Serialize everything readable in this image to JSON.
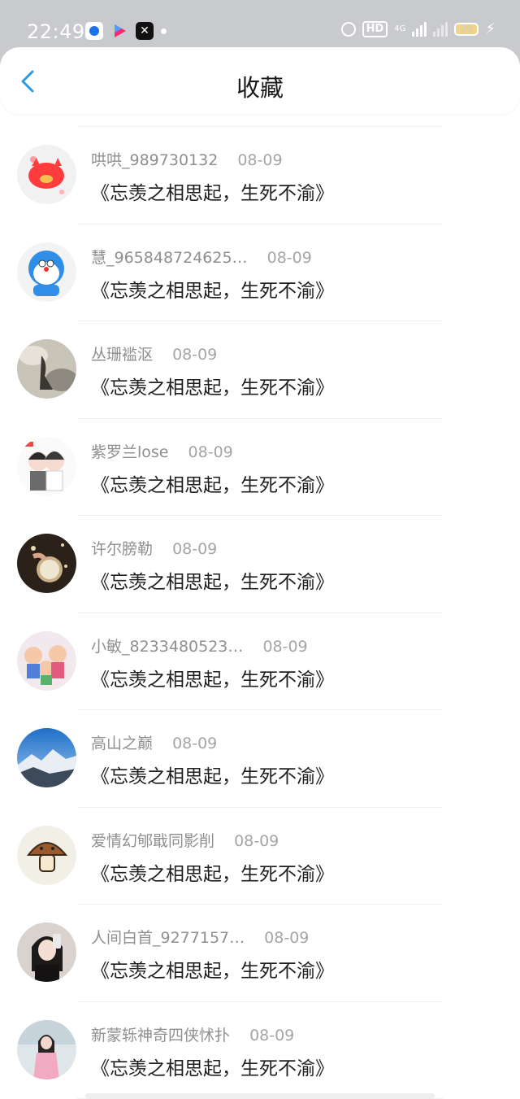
{
  "status_bar": {
    "time": "22:49",
    "hd_badge": "HD",
    "network": "4G",
    "battery": "29"
  },
  "header": {
    "title": "收藏",
    "accent_color": "#2b9ae6"
  },
  "items": [
    {
      "username": "哄哄_989730132",
      "date": "08-09",
      "text": "《忘羡之相思起，生死不渝》",
      "avatar": "pink-pig"
    },
    {
      "username": "慧_965848724625…",
      "date": "08-09",
      "text": "《忘羡之相思起，生死不渝》",
      "avatar": "doraemon"
    },
    {
      "username": "丛珊褴沤",
      "date": "08-09",
      "text": "《忘羡之相思起，生死不渝》",
      "avatar": "misty-figure"
    },
    {
      "username": "紫罗兰lose",
      "date": "08-09",
      "text": "《忘羡之相思起，生死不渝》",
      "avatar": "anime-couple"
    },
    {
      "username": "许尔膀勒",
      "date": "08-09",
      "text": "《忘羡之相思起，生死不渝》",
      "avatar": "pocket-watch"
    },
    {
      "username": "小敏_8233480523…",
      "date": "08-09",
      "text": "《忘羡之相思起，生死不渝》",
      "avatar": "cartoon-family"
    },
    {
      "username": "高山之巅",
      "date": "08-09",
      "text": "《忘羡之相思起，生死不渝》",
      "avatar": "snow-mountain"
    },
    {
      "username": "爱情幻郇戢同影削",
      "date": "08-09",
      "text": "《忘羡之相思起，生死不渝》",
      "avatar": "mushroom"
    },
    {
      "username": "人间白首_9277157…",
      "date": "08-09",
      "text": "《忘羡之相思起，生死不渝》",
      "avatar": "girl-photo"
    },
    {
      "username": "新蒙轹神奇四侠怵扑",
      "date": "08-09",
      "text": "《忘羡之相思起，生死不渝》",
      "avatar": "girl-pink"
    }
  ]
}
